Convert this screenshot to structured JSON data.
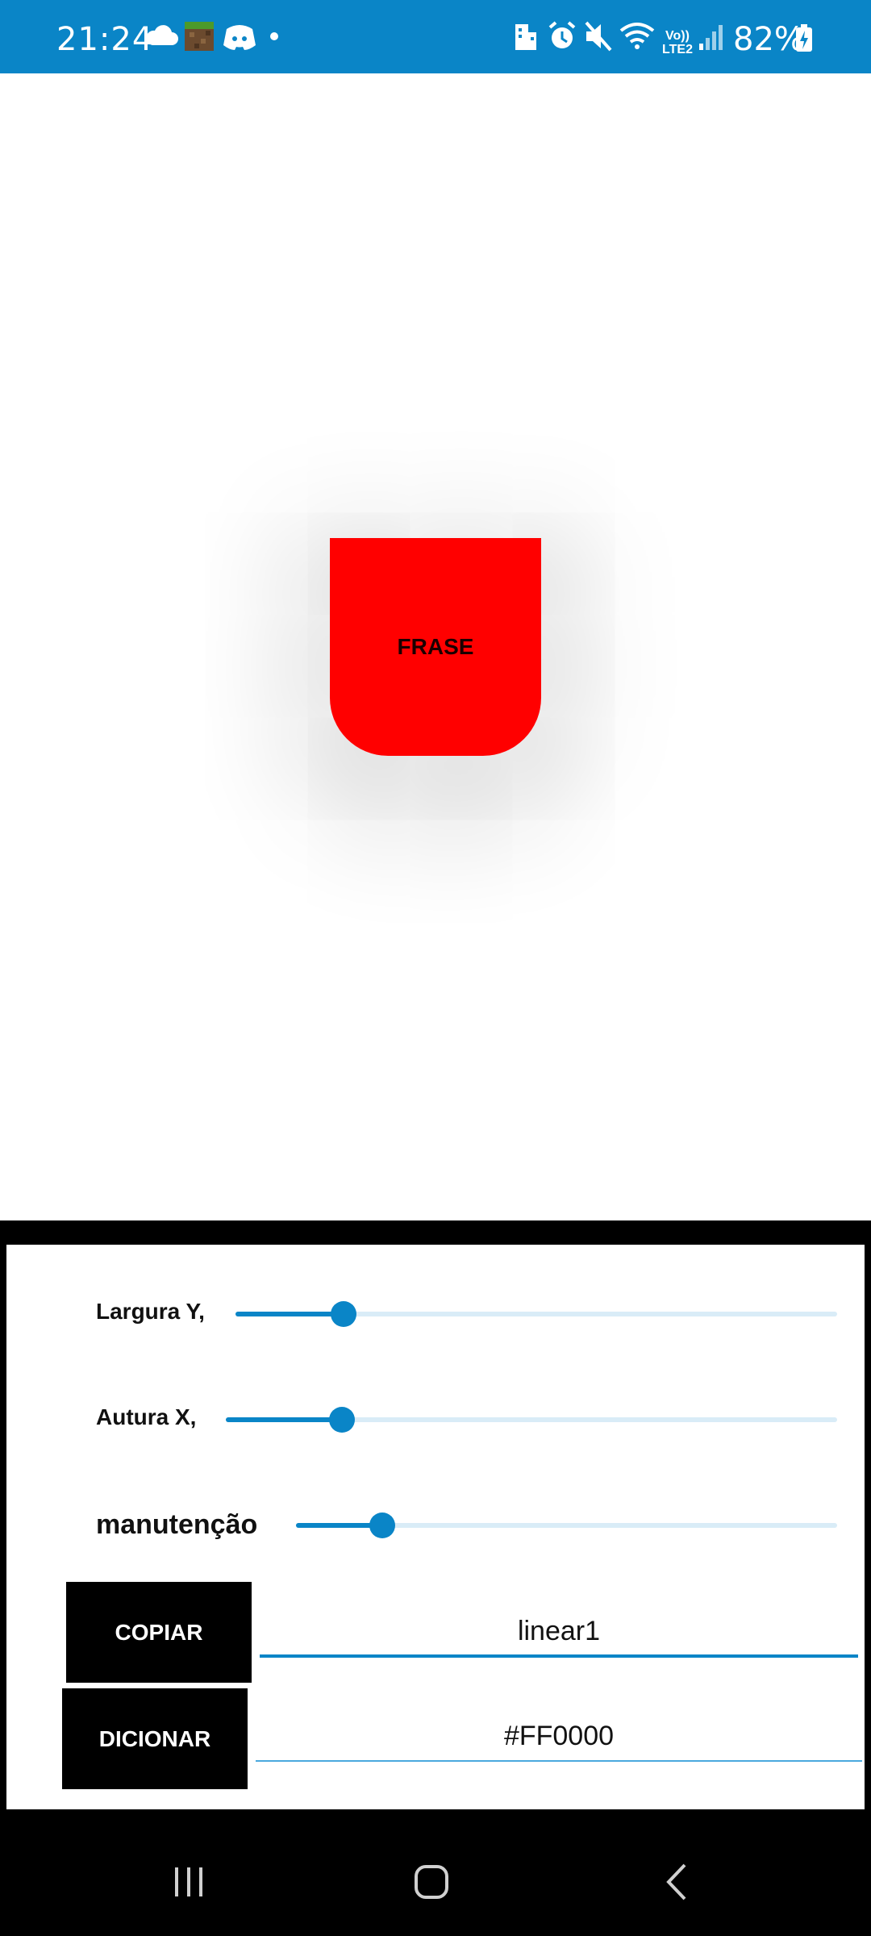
{
  "status_bar": {
    "time": "21:24",
    "battery": "82%",
    "icons": [
      "cloud-icon",
      "minecraft-icon",
      "discord-icon",
      "dot-icon",
      "building-icon",
      "alarm-icon",
      "mute-icon",
      "wifi-icon",
      "volte-icon",
      "signal-icon",
      "battery-charging-icon"
    ],
    "volte_label": "Vo))",
    "lte_label": "LTE2",
    "background": "#0a85c7"
  },
  "preview": {
    "label": "FRASE",
    "color": "#ff0000"
  },
  "controls": {
    "sliders": [
      {
        "label": "Largura Y,",
        "value": 0.18
      },
      {
        "label": "Autura X,",
        "value": 0.19
      },
      {
        "label": "manutenção",
        "value": 0.16
      }
    ],
    "copy_button": "COPIAR",
    "add_button": "DICIONAR",
    "name_field": "linear1",
    "color_field": "#FF0000",
    "accent": "#0a85c7"
  },
  "nav_bar": {
    "buttons": [
      "recents-icon",
      "home-icon",
      "back-icon"
    ]
  }
}
